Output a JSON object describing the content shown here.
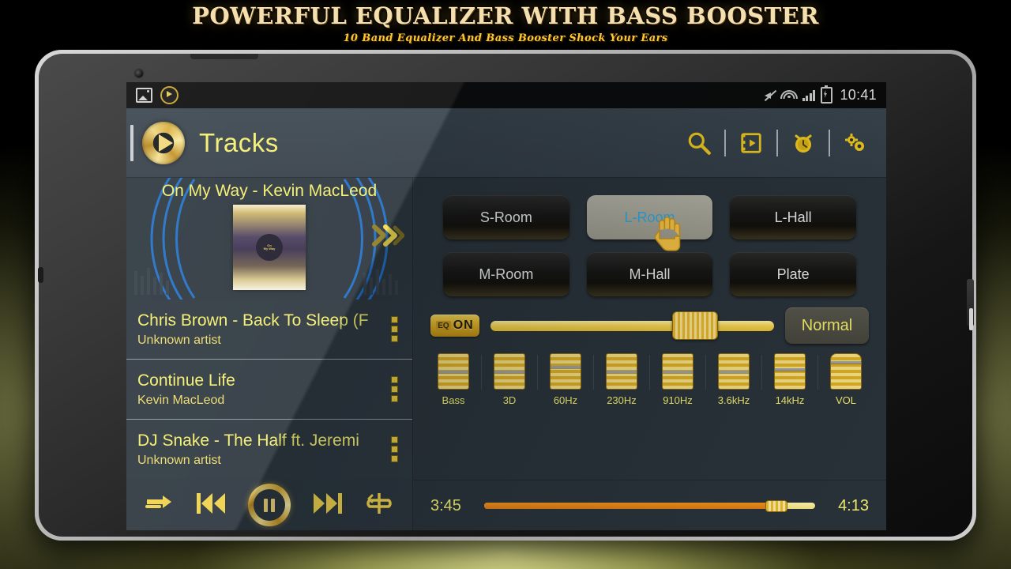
{
  "banner": {
    "title": "POWERFUL EQUALIZER WITH BASS BOOSTER",
    "subtitle": "10 Band Equalizer And Bass Booster Shock Your Ears"
  },
  "statusbar": {
    "time": "10:41",
    "icons": [
      "image-icon",
      "play-circle-icon",
      "mute-icon",
      "wifi-icon",
      "signal-icon",
      "battery-icon"
    ]
  },
  "header": {
    "title": "Tracks",
    "logo_icon": "play-circle-icon",
    "tools": [
      {
        "name": "search-icon",
        "label": "Search"
      },
      {
        "name": "video-add-icon",
        "label": "Video"
      },
      {
        "name": "alarm-clock-icon",
        "label": "Sleep timer"
      },
      {
        "name": "settings-gears-icon",
        "label": "Settings"
      }
    ]
  },
  "now_playing": {
    "title": "On My Way - Kevin MacLeod",
    "art_label_line1": "On",
    "art_label_line2": "My Way",
    "next_icon": "double-chevron-right-icon"
  },
  "tracks": [
    {
      "title": "Chris Brown - Back To Sleep (F",
      "artist": "Unknown artist"
    },
    {
      "title": "Continue Life",
      "artist": "Kevin MacLeod"
    },
    {
      "title": "DJ Snake - The Half ft. Jeremi",
      "artist": "Unknown artist"
    }
  ],
  "transport": [
    {
      "name": "shuffle-arrow-icon",
      "label": "Shuffle"
    },
    {
      "name": "previous-icon",
      "label": "Previous"
    },
    {
      "name": "pause-icon",
      "label": "Pause"
    },
    {
      "name": "next-icon",
      "label": "Next"
    },
    {
      "name": "repeat-icon",
      "label": "Repeat"
    }
  ],
  "presets": [
    {
      "label": "S-Room",
      "selected": false
    },
    {
      "label": "L-Room",
      "selected": true
    },
    {
      "label": "L-Hall",
      "selected": false
    },
    {
      "label": "M-Room",
      "selected": false
    },
    {
      "label": "M-Hall",
      "selected": false
    },
    {
      "label": "Plate",
      "selected": false
    }
  ],
  "eq": {
    "toggle_eq_text": "EQ",
    "toggle_state": "ON",
    "main_slider_percent": 72,
    "preset_button": "Normal",
    "bands": [
      {
        "label": "Bass",
        "level": 50
      },
      {
        "label": "3D",
        "level": 50
      },
      {
        "label": "60Hz",
        "level": 64
      },
      {
        "label": "230Hz",
        "level": 50
      },
      {
        "label": "910Hz",
        "level": 50
      },
      {
        "label": "3.6kHz",
        "level": 50
      },
      {
        "label": "14kHz",
        "level": 57
      },
      {
        "label": "VOL",
        "level": 78
      }
    ]
  },
  "progress": {
    "elapsed": "3:45",
    "total": "4:13",
    "percent": 88
  },
  "colors": {
    "gold": "#f2c91d",
    "yellow_text": "#f4ef6d",
    "selected_text": "#2aa8e0",
    "orange_fill": "#f0921c",
    "screen_bg": "#2b353d"
  }
}
